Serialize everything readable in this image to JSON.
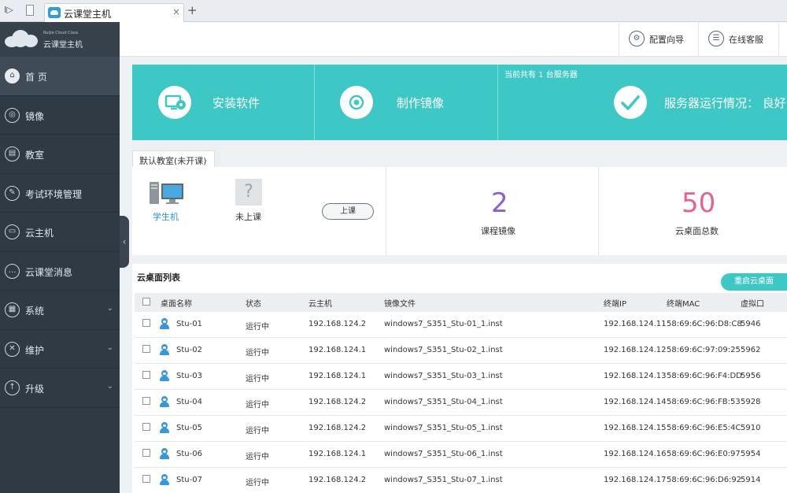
{
  "browser": {
    "tab_title": "云课堂主机",
    "tab_close": "×",
    "new_tab": "+",
    "nav_glyph": "I▷"
  },
  "brand": {
    "sub": "Ruijie Cloud Class",
    "name": "云课堂主机"
  },
  "sidebar": {
    "items": [
      {
        "label": "首 页",
        "icon": "home-icon",
        "glyph": "⌂",
        "active": true
      },
      {
        "label": "镜像",
        "icon": "disc-icon",
        "glyph": "◎"
      },
      {
        "label": "教室",
        "icon": "building-icon",
        "glyph": "▤"
      },
      {
        "label": "考试环境管理",
        "icon": "exam-icon",
        "glyph": "✎"
      },
      {
        "label": "云主机",
        "icon": "server-icon",
        "glyph": "▭"
      },
      {
        "label": "云课堂消息",
        "icon": "message-icon",
        "glyph": "…"
      },
      {
        "label": "系统",
        "icon": "grid-icon",
        "glyph": "▦",
        "chevron": "⌄"
      },
      {
        "label": "维护",
        "icon": "wrench-icon",
        "glyph": "✕",
        "chevron": "⌄"
      },
      {
        "label": "升级",
        "icon": "upgrade-icon",
        "glyph": "↑",
        "chevron": "⌄"
      }
    ],
    "collapse_glyph": "‹"
  },
  "header": {
    "config_wizard": "配置向导",
    "online_service": "在线客服",
    "config_glyph": "⚙",
    "service_glyph": "☰"
  },
  "banner": {
    "install_software": "安装软件",
    "make_image": "制作镜像",
    "server_note": "当前共有 1 台服务器",
    "server_status": "服务器运行情况： 良好",
    "color": "#3ec8c5"
  },
  "classroom": {
    "tab": "默认教室(未开课)",
    "student_pc": "学生机",
    "not_in_class": "未上课",
    "q_glyph": "?",
    "start_class": "上课",
    "course_images_count": "2",
    "course_images_label": "课程镜像",
    "desktops_total_count": "50",
    "desktops_total_label": "云桌面总数",
    "count_colors": {
      "images": "#8a5fcf",
      "desktops": "#e7608f"
    }
  },
  "desktop_list": {
    "title": "云桌面列表",
    "restart_button": "重启云桌面",
    "columns": [
      "桌面名称",
      "状态",
      "云主机",
      "镜像文件",
      "终端IP",
      "终端MAC",
      "虚拟口"
    ],
    "rows": [
      [
        "Stu-01",
        "运行中",
        "192.168.124.2",
        "windows7_S351_Stu-01_1.inst",
        "192.168.124.11",
        "58:69:6C:96:D8:C8",
        "5946"
      ],
      [
        "Stu-02",
        "运行中",
        "192.168.124.1",
        "windows7_S351_Stu-02_1.inst",
        "192.168.124.12",
        "58:69:6C:97:09:25",
        "5962"
      ],
      [
        "Stu-03",
        "运行中",
        "192.168.124.1",
        "windows7_S351_Stu-03_1.inst",
        "192.168.124.13",
        "58:69:6C:96:F4:DD",
        "5956"
      ],
      [
        "Stu-04",
        "运行中",
        "192.168.124.2",
        "windows7_S351_Stu-04_1.inst",
        "192.168.124.14",
        "58:69:6C:96:FB:53",
        "5928"
      ],
      [
        "Stu-05",
        "运行中",
        "192.168.124.2",
        "windows7_S351_Stu-05_1.inst",
        "192.168.124.15",
        "58:69:6C:96:E5:4C",
        "5910"
      ],
      [
        "Stu-06",
        "运行中",
        "192.168.124.1",
        "windows7_S351_Stu-06_1.inst",
        "192.168.124.16",
        "58:69:6C:96:E0:97",
        "5954"
      ],
      [
        "Stu-07",
        "运行中",
        "192.168.124.2",
        "windows7_S351_Stu-07_1.inst",
        "192.168.124.17",
        "58:69:6C:96:D6:92",
        "5914"
      ]
    ]
  }
}
